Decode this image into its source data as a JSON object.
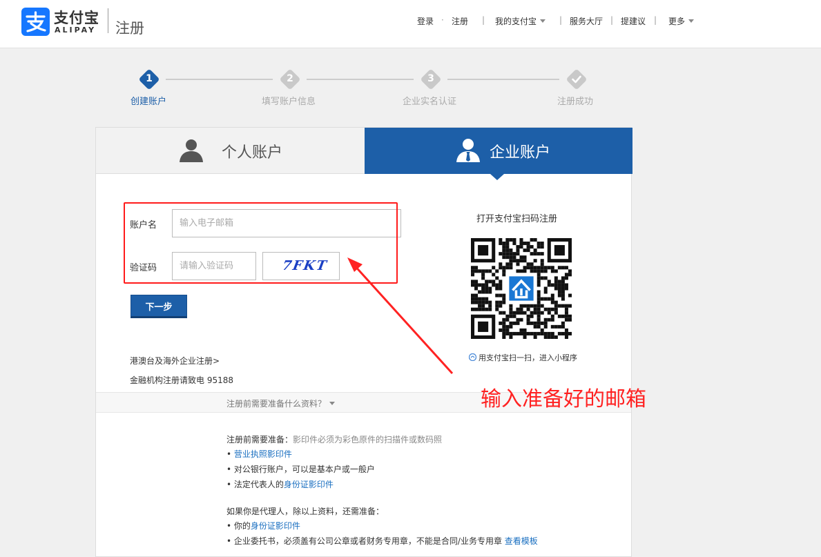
{
  "header": {
    "logo_cn": "支付宝",
    "logo_en": "ALIPAY",
    "page_name": "注册",
    "nav": {
      "login": "登录",
      "dot": "·",
      "register": "注册",
      "my_alipay": "我的支付宝",
      "sep": "|",
      "service_hall": "服务大厅",
      "suggest": "提建议",
      "more": "更多"
    }
  },
  "steps": [
    {
      "num": "1",
      "label": "创建账户"
    },
    {
      "num": "2",
      "label": "填写账户信息"
    },
    {
      "num": "3",
      "label": "企业实名认证"
    },
    {
      "num": "",
      "label": "注册成功"
    }
  ],
  "tabs": {
    "personal": "个人账户",
    "business": "企业账户"
  },
  "form": {
    "account_label": "账户名",
    "account_placeholder": "输入电子邮箱",
    "captcha_label": "验证码",
    "captcha_placeholder": "请输入验证码",
    "captcha_text": "7FKT",
    "next_button": "下一步",
    "overseas_link": "港澳台及海外企业注册>",
    "finance_text": "金融机构注册请致电",
    "finance_phone": "95188"
  },
  "qr": {
    "title": "打开支付宝扫码注册",
    "hint": "用支付宝扫一扫，进入小程序"
  },
  "prep": {
    "toggle": "注册前需要准备什么资料？",
    "intro_bold": "注册前需要准备：",
    "intro_note": "影印件必须为彩色原件的扫描件或数码照",
    "bullet": "•",
    "item1": "营业执照影印件",
    "item2": "对公银行账户，可以是基本户或一般户",
    "item3_prefix": "法定代表人的",
    "item3_link": "身份证影印件",
    "agent_intro": "如果你是代理人，除以上资料，还需准备：",
    "agent1_prefix": "你的",
    "agent1_link": "身份证影印件",
    "agent2": "企业委托书，必须盖有公司公章或者财务专用章，不能是合同/业务专用章",
    "agent2_link": "查看模板"
  },
  "annotation": "输入准备好的邮箱",
  "colors": {
    "brand_blue": "#1677ff",
    "active_blue": "#1d5fa8",
    "link_blue": "#1a6fc0",
    "annotation_red": "#ff2222"
  }
}
